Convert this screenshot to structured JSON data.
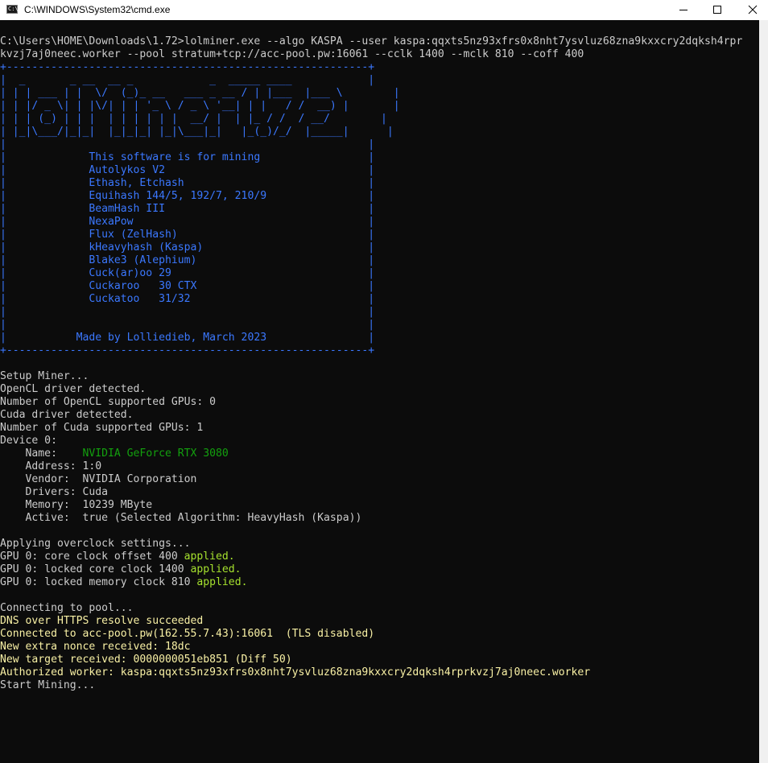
{
  "window": {
    "title": "C:\\WINDOWS\\System32\\cmd.exe",
    "icon": "cmd-app-icon",
    "icon_prompt": "C:\\",
    "buttons": {
      "minimize": "─",
      "maximize": "☐",
      "close": "✕"
    }
  },
  "console": {
    "lines": [
      {
        "t": "C:\\Users\\HOME\\Downloads\\1.72>lolminer.exe --algo KASPA --user kaspa:qqxts5nz93xfrs0x8nht7ysvluz68zna9kxxcry2dqksh4rpr",
        "c": "normal"
      },
      {
        "t": "kvzj7aj0neec.worker --pool stratum+tcp://acc-pool.pw:16061 --cclk 1400 --mclk 810 --coff 400",
        "c": "normal"
      },
      {
        "t": "+---------------------------------------------------------+",
        "c": "box"
      },
      {
        "t": "|  _       _ __  __ _            _  _____ ____            |",
        "c": "box"
      },
      {
        "t": "| | | ___ | |  \\/  (_)_ __   ___ _ __ / | |___  |___ \\        |",
        "c": "box"
      },
      {
        "t": "| | |/ _ \\| | |\\/| | | '_ \\ / _ \\ '__| | |   / /  __) |       |",
        "c": "box"
      },
      {
        "t": "| | | (_) | | |  | | | | | |  __/ |  | |_ / /  / __/        |",
        "c": "box"
      },
      {
        "t": "| |_|\\___/|_|_|  |_|_|_| |_|\\___|_|   |_(_)/_/  |_____|      |",
        "c": "box"
      },
      {
        "t": "|                                                         |",
        "c": "box"
      },
      {
        "t": "|             This software is for mining                 |",
        "c": "box"
      },
      {
        "t": "|             Autolykos V2                                |",
        "c": "box"
      },
      {
        "t": "|             Ethash, Etchash                             |",
        "c": "box"
      },
      {
        "t": "|             Equihash 144/5, 192/7, 210/9                |",
        "c": "box"
      },
      {
        "t": "|             BeamHash III                                |",
        "c": "box"
      },
      {
        "t": "|             NexaPow                                     |",
        "c": "box"
      },
      {
        "t": "|             Flux (ZelHash)                              |",
        "c": "box"
      },
      {
        "t": "|             kHeavyhash (Kaspa)                          |",
        "c": "box"
      },
      {
        "t": "|             Blake3 (Alephium)                           |",
        "c": "box"
      },
      {
        "t": "|             Cuck(ar)oo 29                               |",
        "c": "box"
      },
      {
        "t": "|             Cuckaroo   30 CTX                           |",
        "c": "box"
      },
      {
        "t": "|             Cuckatoo   31/32                            |",
        "c": "box"
      },
      {
        "t": "|                                                         |",
        "c": "box"
      },
      {
        "t": "|                                                         |",
        "c": "box"
      },
      {
        "t": "|           Made by Lolliedieb, March 2023                |",
        "c": "box"
      },
      {
        "t": "+---------------------------------------------------------+",
        "c": "box"
      },
      {
        "t": "",
        "c": "normal"
      },
      {
        "t": "Setup Miner...",
        "c": "normal"
      },
      {
        "t": "OpenCL driver detected.",
        "c": "normal"
      },
      {
        "t": "Number of OpenCL supported GPUs: 0",
        "c": "normal"
      },
      {
        "t": "Cuda driver detected.",
        "c": "normal"
      },
      {
        "t": "Number of Cuda supported GPUs: 1",
        "c": "normal"
      },
      {
        "t": "Device 0:",
        "c": "normal"
      },
      {
        "segs": [
          {
            "t": "    Name:    ",
            "c": "normal"
          },
          {
            "t": "NVIDIA GeForce RTX 3080",
            "c": "green"
          }
        ]
      },
      {
        "t": "    Address: 1:0",
        "c": "normal"
      },
      {
        "t": "    Vendor:  NVIDIA Corporation",
        "c": "normal"
      },
      {
        "t": "    Drivers: Cuda",
        "c": "normal"
      },
      {
        "t": "    Memory:  10239 MByte",
        "c": "normal"
      },
      {
        "t": "    Active:  true (Selected Algorithm: HeavyHash (Kaspa))",
        "c": "normal"
      },
      {
        "t": "",
        "c": "normal"
      },
      {
        "t": "Applying overclock settings...",
        "c": "normal"
      },
      {
        "segs": [
          {
            "t": "GPU 0: core clock offset 400 ",
            "c": "normal"
          },
          {
            "t": "applied.",
            "c": "lime"
          }
        ]
      },
      {
        "segs": [
          {
            "t": "GPU 0: locked core clock 1400 ",
            "c": "normal"
          },
          {
            "t": "applied.",
            "c": "lime"
          }
        ]
      },
      {
        "segs": [
          {
            "t": "GPU 0: locked memory clock 810 ",
            "c": "normal"
          },
          {
            "t": "applied.",
            "c": "lime"
          }
        ]
      },
      {
        "t": "",
        "c": "normal"
      },
      {
        "t": "Connecting to pool...",
        "c": "normal"
      },
      {
        "t": "DNS over HTTPS resolve succeeded",
        "c": "yellow"
      },
      {
        "t": "Connected to acc-pool.pw(162.55.7.43):16061  (TLS disabled)",
        "c": "yellow"
      },
      {
        "t": "New extra nonce received: 18dc",
        "c": "yellow"
      },
      {
        "t": "New target received: 0000000051eb851 (Diff 50)",
        "c": "yellow"
      },
      {
        "t": "Authorized worker: kaspa:qqxts5nz93xfrs0x8nht7ysvluz68zna9kxxcry2dqksh4rprkvzj7aj0neec.worker",
        "c": "yellow"
      },
      {
        "t": "Start Mining...",
        "c": "normal"
      }
    ]
  }
}
